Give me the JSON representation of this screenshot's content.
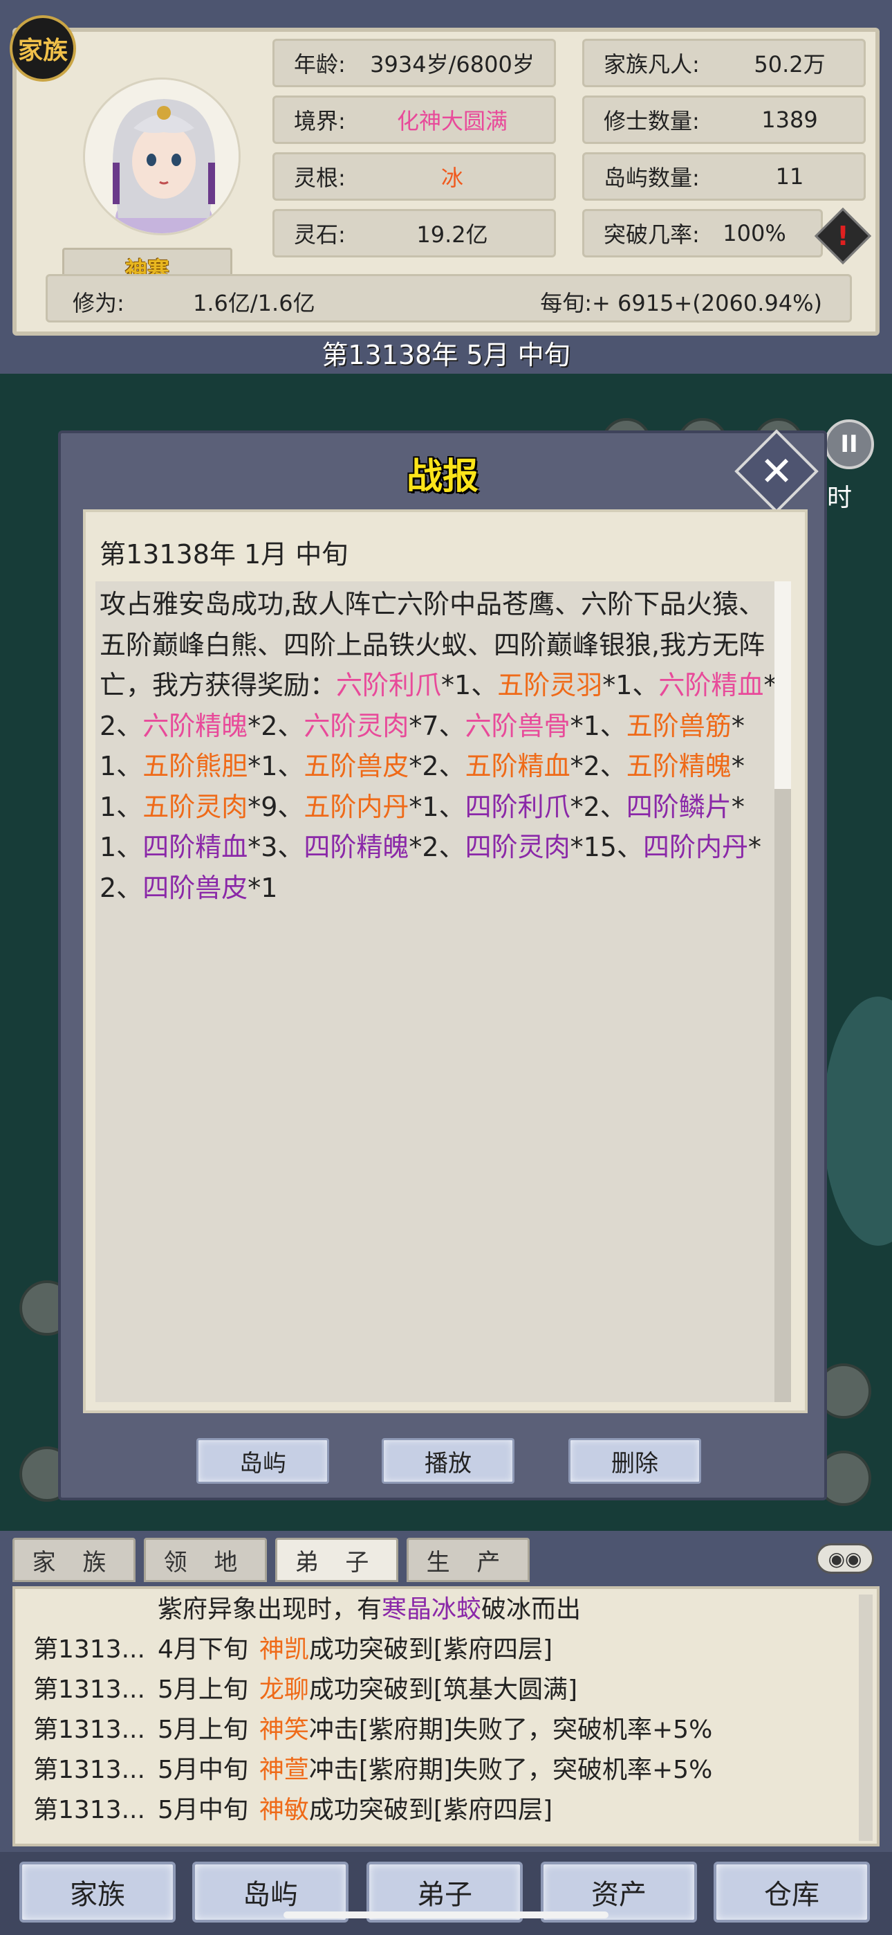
{
  "header": {
    "clan_badge": "家族",
    "player_name": "神寒",
    "stats": {
      "age_label": "年龄:",
      "age_value": "3934岁/6800岁",
      "realm_label": "境界:",
      "realm_value": "化神大圆满",
      "root_label": "灵根:",
      "root_value": "冰",
      "stones_label": "灵石:",
      "stones_value": "19.2亿",
      "mortals_label": "家族凡人:",
      "mortals_value": "50.2万",
      "cultivators_label": "修士数量:",
      "cultivators_value": "1389",
      "islands_label": "岛屿数量:",
      "islands_value": "11",
      "breakthrough_label": "突破几率:",
      "breakthrough_value": "100%"
    },
    "cultivation_label": "修为:",
    "cultivation_value": "1.6亿/1.6亿",
    "cultivation_rate": "每旬:+ 6915+(2060.94%)",
    "warning_icon": "exclamation-icon",
    "date": "第13138年 5月 中旬"
  },
  "game": {
    "pause_icon": "pause-icon",
    "time_label": "时"
  },
  "report": {
    "title": "战报",
    "close_icon": "close-icon",
    "date": "第13138年 1月 中旬",
    "segments": [
      {
        "text": "攻占雅安岛成功,敌人阵亡六阶中品苍鹰、六阶下品火猿、五阶巅峰白熊、四阶上品铁火蚁、四阶巅峰银狼,我方无阵亡，我方获得奖励：",
        "c": ""
      },
      {
        "text": "六阶利爪",
        "c": "c-pink"
      },
      {
        "text": "*1、",
        "c": ""
      },
      {
        "text": "五阶灵羽",
        "c": "c-orange"
      },
      {
        "text": "*1、",
        "c": ""
      },
      {
        "text": "六阶精血",
        "c": "c-pink"
      },
      {
        "text": "*2、",
        "c": ""
      },
      {
        "text": "六阶精魄",
        "c": "c-pink"
      },
      {
        "text": "*2、",
        "c": ""
      },
      {
        "text": "六阶灵肉",
        "c": "c-pink"
      },
      {
        "text": "*7、",
        "c": ""
      },
      {
        "text": "六阶兽骨",
        "c": "c-pink"
      },
      {
        "text": "*1、",
        "c": ""
      },
      {
        "text": "五阶兽筋",
        "c": "c-orange"
      },
      {
        "text": "*1、",
        "c": ""
      },
      {
        "text": "五阶熊胆",
        "c": "c-orange"
      },
      {
        "text": "*1、",
        "c": ""
      },
      {
        "text": "五阶兽皮",
        "c": "c-orange"
      },
      {
        "text": "*2、",
        "c": ""
      },
      {
        "text": "五阶精血",
        "c": "c-orange"
      },
      {
        "text": "*2、",
        "c": ""
      },
      {
        "text": "五阶精魄",
        "c": "c-orange"
      },
      {
        "text": "*1、",
        "c": ""
      },
      {
        "text": "五阶灵肉",
        "c": "c-orange"
      },
      {
        "text": "*9、",
        "c": ""
      },
      {
        "text": "五阶内丹",
        "c": "c-orange"
      },
      {
        "text": "*1、",
        "c": ""
      },
      {
        "text": "四阶利爪",
        "c": "c-purple"
      },
      {
        "text": "*2、",
        "c": ""
      },
      {
        "text": "四阶鳞片",
        "c": "c-purple"
      },
      {
        "text": "*1、",
        "c": ""
      },
      {
        "text": "四阶精血",
        "c": "c-purple"
      },
      {
        "text": "*3、",
        "c": ""
      },
      {
        "text": "四阶精魄",
        "c": "c-purple"
      },
      {
        "text": "*2、",
        "c": ""
      },
      {
        "text": "四阶灵肉",
        "c": "c-purple"
      },
      {
        "text": "*15、",
        "c": ""
      },
      {
        "text": "四阶内丹",
        "c": "c-purple"
      },
      {
        "text": "*2、",
        "c": ""
      },
      {
        "text": "四阶兽皮",
        "c": "c-purple"
      },
      {
        "text": "*1",
        "c": ""
      }
    ],
    "buttons": {
      "island": "岛屿",
      "play": "播放",
      "delete": "删除"
    }
  },
  "log": {
    "tabs": [
      "家 族",
      "领 地",
      "弟 子",
      "生 产"
    ],
    "settings_icon": "settings-toggle-icon",
    "first_line": {
      "pre": "紫府异象出现时，有",
      "beast": "寒晶冰蛟",
      "post": "破冰而出"
    },
    "entries": [
      {
        "date": "第1313...",
        "period": "4月下旬",
        "name": "神凯",
        "text": "成功突破到[紫府四层]"
      },
      {
        "date": "第1313...",
        "period": "5月上旬",
        "name": "龙聊",
        "text": "成功突破到[筑基大圆满]"
      },
      {
        "date": "第1313...",
        "period": "5月上旬",
        "name": "神笑",
        "text": "冲击[紫府期]失败了，突破机率+5%"
      },
      {
        "date": "第1313...",
        "period": "5月中旬",
        "name": "神萱",
        "text": "冲击[紫府期]失败了，突破机率+5%"
      },
      {
        "date": "第1313...",
        "period": "5月中旬",
        "name": "神敏",
        "text": "成功突破到[紫府四层]"
      }
    ]
  },
  "nav": [
    "家族",
    "岛屿",
    "弟子",
    "资产",
    "仓库"
  ]
}
